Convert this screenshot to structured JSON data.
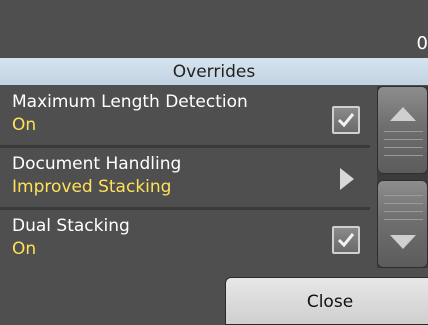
{
  "counter": "0",
  "header": {
    "title": "Overrides"
  },
  "items": [
    {
      "label": "Maximum Length Detection",
      "value": "On",
      "control": "checkbox-checked-icon"
    },
    {
      "label": "Document Handling",
      "value": "Improved Stacking",
      "control": "chevron-right-icon"
    },
    {
      "label": "Dual Stacking",
      "value": "On",
      "control": "checkbox-checked-icon"
    }
  ],
  "scroll": {
    "up_icon": "triangle-up-icon",
    "down_icon": "triangle-down-icon"
  },
  "footer": {
    "close_label": "Close"
  },
  "colors": {
    "background": "#4f4f4f",
    "header": "#c9d9e7",
    "value": "#ffe15a"
  }
}
